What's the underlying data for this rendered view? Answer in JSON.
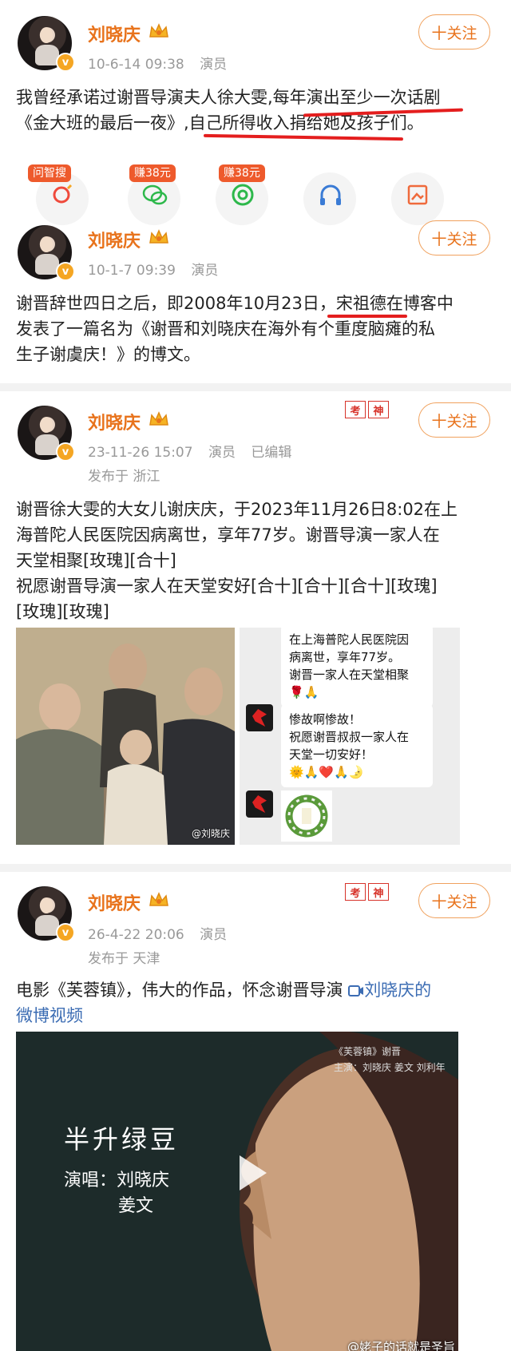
{
  "colors": {
    "name": "#e8731c",
    "link": "#3b6cb3",
    "underline": "#e41e1e",
    "stamp": "#d7332a"
  },
  "follow_label": "十关注",
  "posts": [
    {
      "name": "刘晓庆",
      "date": "10-6-14 09:38",
      "role": "演员",
      "text_lines": [
        "我曾经承诺过谢晋导演夫人徐大雯,每年演出至少一次话剧",
        "《金大班的最后一夜》,自己所得收入捐给她及孩子们。"
      ],
      "actions": [
        {
          "tag": "问智搜",
          "icon": "search-ai-icon"
        },
        {
          "tag": "赚38元",
          "icon": "wechat-icon"
        },
        {
          "tag": "赚38元",
          "icon": "moments-icon"
        },
        {
          "tag": "",
          "icon": "headphone-icon"
        },
        {
          "tag": "",
          "icon": "save-image-icon"
        }
      ]
    },
    {
      "name": "刘晓庆",
      "date": "10-1-7 09:39",
      "role": "演员",
      "text_lines": [
        "谢晋辞世四日之后，即2008年10月23日，宋祖德在博客中",
        "发表了一篇名为《谢晋和刘晓庆在海外有个重度脑瘫的私",
        "生子谢虞庆！》的博文。"
      ]
    },
    {
      "name": "刘晓庆",
      "date": "23-11-26 15:07",
      "role": "演员",
      "edited": "已编辑",
      "location": "发布于 浙江",
      "stamp": [
        "考",
        "神"
      ],
      "text_lines": [
        "谢晋徐大雯的大女儿谢庆庆，于2023年11月26日8:02在上",
        "海普陀人民医院因病离世，享年77岁。谢晋导演一家人在",
        "天堂相聚[玫瑰][合十]",
        "祝愿谢晋导演一家人在天堂安好[合十][合十][合十][玫瑰]",
        "[玫瑰][玫瑰]"
      ],
      "photo_watermark": "@刘晓庆",
      "chat": {
        "bubble1": [
          "在上海普陀人民医院因",
          "病离世，享年77岁。",
          "谢晋一家人在天堂相聚"
        ],
        "bubble2": [
          "惨故啊惨故！",
          "祝愿谢晋叔叔一家人在",
          "天堂一切安好！"
        ]
      }
    },
    {
      "name": "刘晓庆",
      "date": "26-4-22 20:06",
      "role": "演员",
      "location": "发布于 天津",
      "stamp": [
        "考",
        "神"
      ],
      "text_prefix": "电影《芙蓉镇》，伟大的作品，怀念谢晋导演 ",
      "video_link": "刘晓庆的",
      "video_link2": "微博视频",
      "video": {
        "credit1": "《芙蓉镇》谢晋",
        "credit2": "主演：刘晓庆 姜文 刘利年",
        "title": "半升绿豆",
        "singers1": "演唱：刘晓庆",
        "singers2": "姜文"
      }
    }
  ],
  "page_watermark": "@姥子的话就是圣旨"
}
